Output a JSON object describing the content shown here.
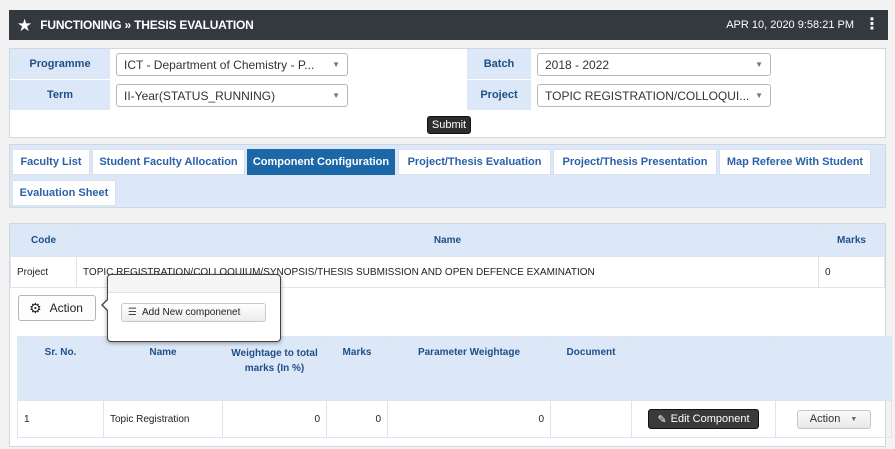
{
  "header": {
    "title": "FUNCTIONING » THESIS EVALUATION",
    "datetime": "APR 10, 2020   9:58:21 PM"
  },
  "filters": {
    "programme_label": "Programme",
    "programme_value": "ICT - Department of Chemistry - P...",
    "batch_label": "Batch",
    "batch_value": "2018 - 2022",
    "term_label": "Term",
    "term_value": "II-Year(STATUS_RUNNING)",
    "project_label": "Project",
    "project_value": "TOPIC REGISTRATION/COLLOQUI...",
    "submit_label": "Submit"
  },
  "tabs": [
    {
      "label": "Faculty List",
      "active": false
    },
    {
      "label": "Student Faculty Allocation",
      "active": false
    },
    {
      "label": "Component Configuration",
      "active": true
    },
    {
      "label": "Project/Thesis Evaluation",
      "active": false
    },
    {
      "label": "Project/Thesis Presentation",
      "active": false
    },
    {
      "label": "Map Referee With Student",
      "active": false
    },
    {
      "label": "Evaluation Sheet",
      "active": false
    }
  ],
  "project_table": {
    "headers": [
      "Code",
      "Name",
      "Marks"
    ],
    "row": {
      "code": "Project",
      "name": "TOPIC REGISTRATION/COLLOQUIUM/SYNOPSIS/THESIS SUBMISSION AND OPEN DEFENCE EXAMINATION",
      "marks": "0"
    }
  },
  "action": {
    "label": "Action",
    "menu_item": "Add New componenet"
  },
  "component_table": {
    "headers": {
      "sr": "Sr. No.",
      "name": "Name",
      "weightage": "Weightage to total marks (In %)",
      "marks": "Marks",
      "param": "Parameter Weightage",
      "document": "Document"
    },
    "row": {
      "sr": "1",
      "name": "Topic Registration",
      "weightage": "0",
      "marks": "0",
      "param": "0",
      "edit_label": "Edit Component",
      "action_label": "Action"
    }
  }
}
